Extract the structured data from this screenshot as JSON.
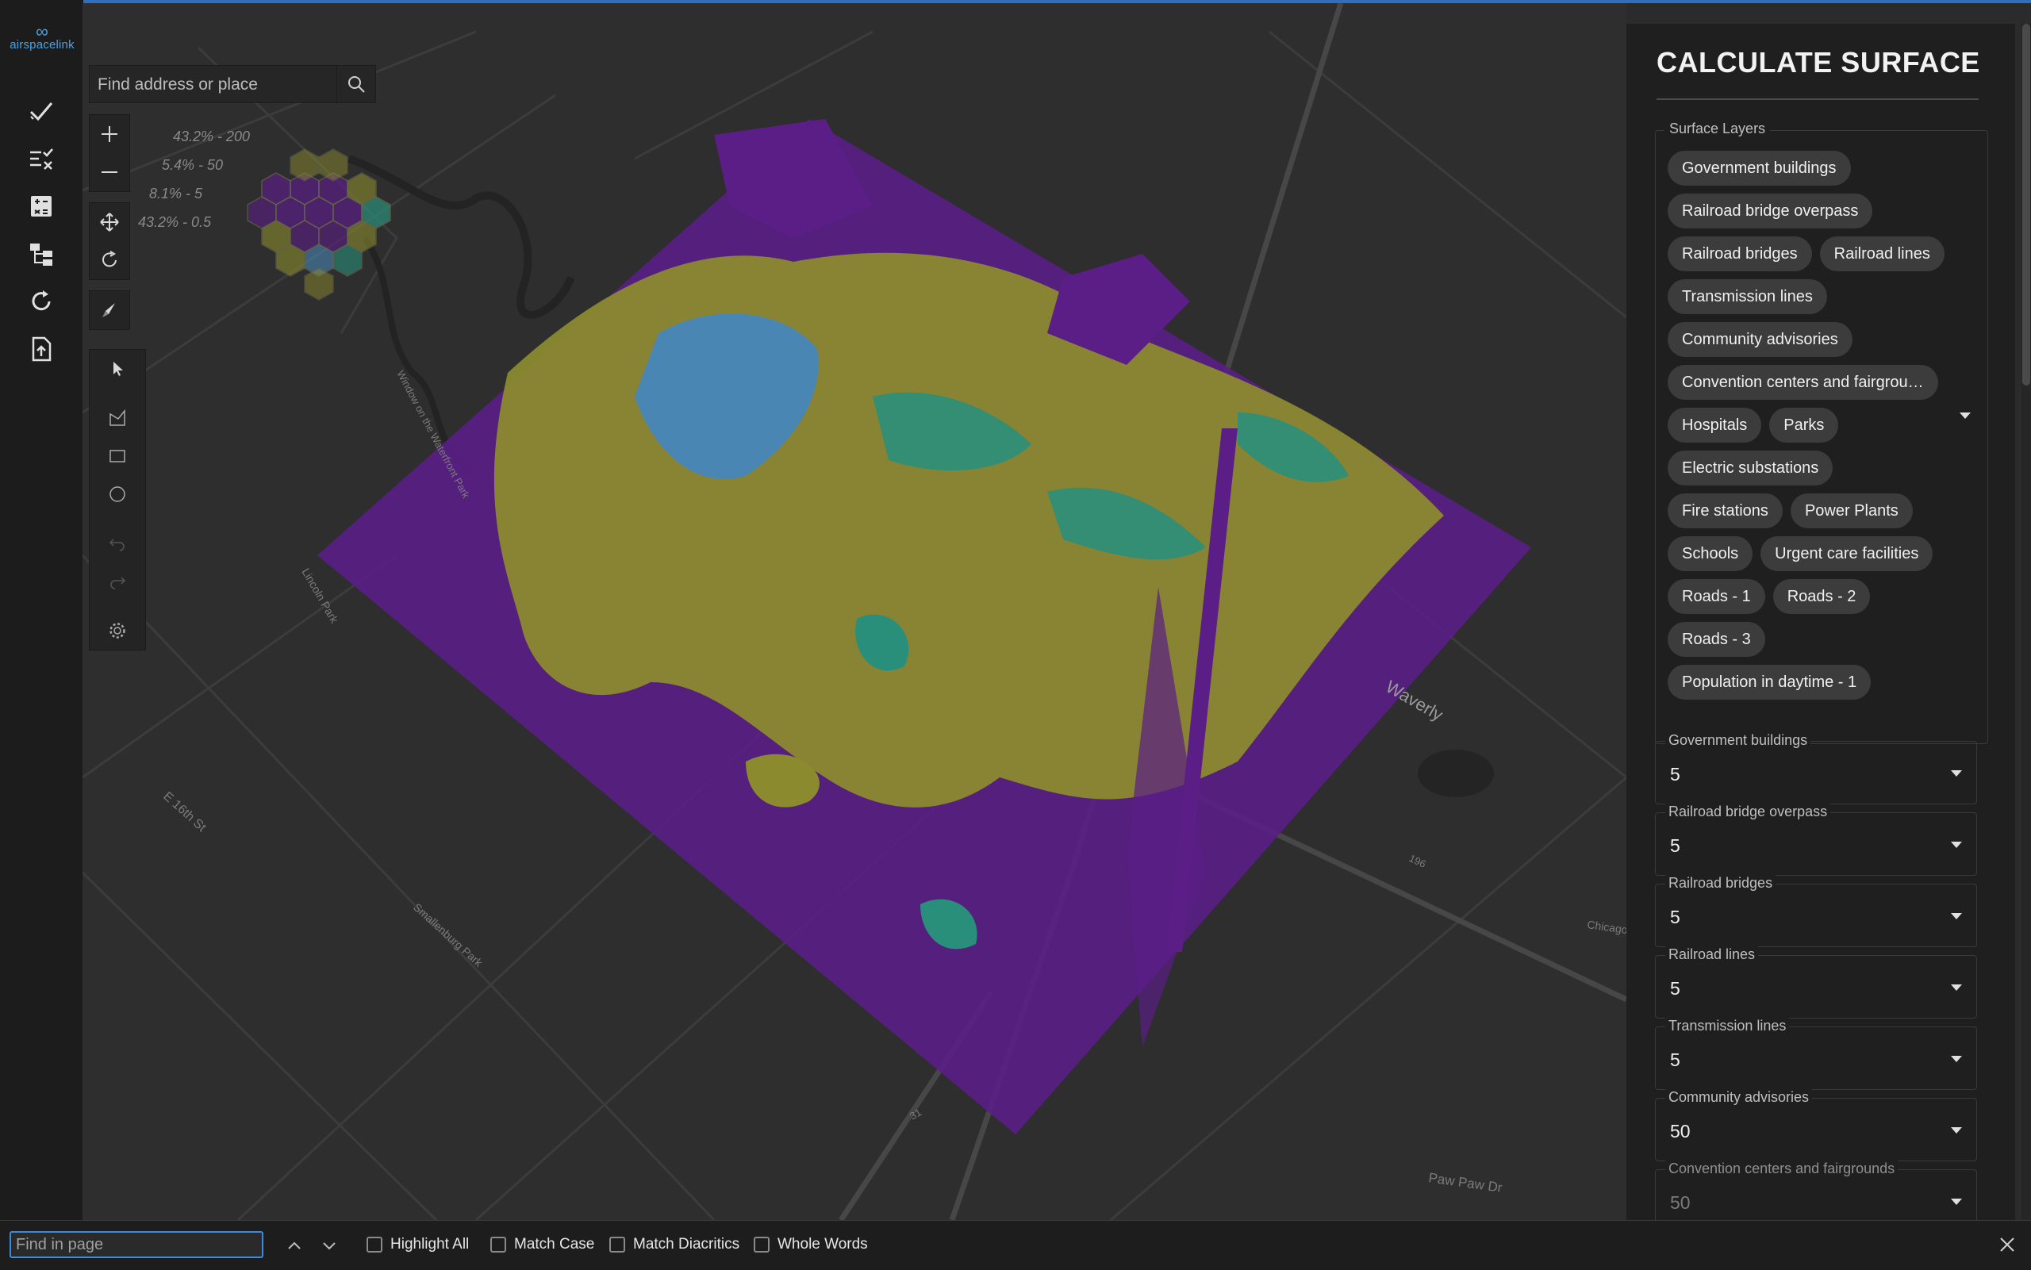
{
  "app": {
    "brand": "airspacelink"
  },
  "rail": {
    "items": [
      {
        "name": "check-icon"
      },
      {
        "name": "checklist-icon"
      },
      {
        "name": "calculator-icon"
      },
      {
        "name": "hierarchy-icon"
      },
      {
        "name": "refresh-icon"
      },
      {
        "name": "file-upload-icon"
      }
    ]
  },
  "search": {
    "placeholder": "Find address or place"
  },
  "legend": {
    "labels": [
      "43.2% - 200",
      "5.4% - 50",
      "8.1% - 5",
      "43.2% - 0.5"
    ]
  },
  "panel": {
    "title": "CALCULATE SURFACE",
    "surface_layers_label": "Surface Layers",
    "chips": [
      "Government buildings",
      "Railroad bridge overpass",
      "Railroad bridges",
      "Railroad lines",
      "Transmission lines",
      "Community advisories",
      "Convention centers and fairgrou…",
      "Hospitals",
      "Parks",
      "Electric substations",
      "Fire stations",
      "Power Plants",
      "Schools",
      "Urgent care facilities",
      "Roads - 1",
      "Roads - 2",
      "Roads - 3",
      "Population in daytime - 1"
    ],
    "fields": [
      {
        "label": "Government buildings",
        "value": "5"
      },
      {
        "label": "Railroad bridge overpass",
        "value": "5"
      },
      {
        "label": "Railroad bridges",
        "value": "5"
      },
      {
        "label": "Railroad lines",
        "value": "5"
      },
      {
        "label": "Transmission lines",
        "value": "5"
      },
      {
        "label": "Community advisories",
        "value": "50"
      },
      {
        "label": "Convention centers and fairgrounds",
        "value": "50"
      }
    ]
  },
  "findbar": {
    "placeholder": "Find in page",
    "highlight_all": "Highlight All",
    "match_case": "Match Case",
    "match_diacritics": "Match Diacritics",
    "whole_words": "Whole Words"
  },
  "map_labels": [
    "Waverly",
    "Paw Paw Dr",
    "E 16th St",
    "Lincoln Park",
    "Smallenburg Park",
    "Window on the Waterfront Park",
    "196",
    "31",
    "Chicago Dr"
  ],
  "colors": {
    "accent": "#2f6fbd",
    "purple": "#5a1e86",
    "olive": "#8b8a2f",
    "teal": "#2a8f7a",
    "blue": "#4a86b4"
  }
}
